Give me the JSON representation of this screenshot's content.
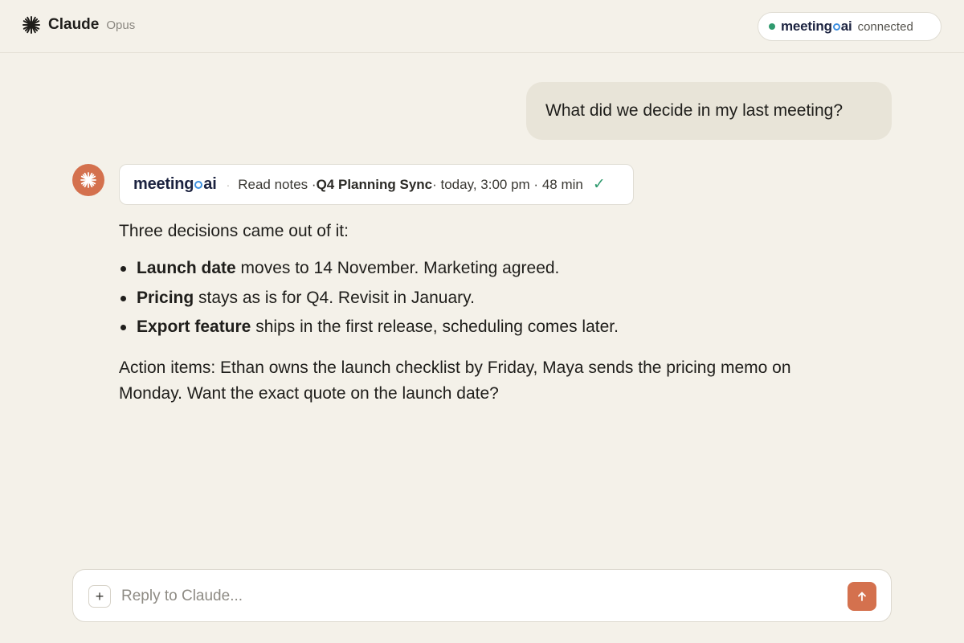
{
  "header": {
    "app_name": "Claude",
    "model": "Opus",
    "connection": {
      "brand_prefix": "meeting",
      "brand_suffix": "ai",
      "status": "connected",
      "status_color": "#2f9a6e"
    }
  },
  "conversation": {
    "user_message": "What did we decide in my last meeting?",
    "tool_call": {
      "brand_prefix": "meeting",
      "brand_suffix": "ai",
      "separator": "·",
      "action": "Read notes · ",
      "meeting_title": "Q4 Planning Sync",
      "details": " · today, 3:00 pm · 48 min",
      "check": "✓",
      "check_icon": "check-icon"
    },
    "reply": {
      "intro": "Three decisions came out of it:",
      "decisions": [
        {
          "bold": "Launch date",
          "text": " moves to 14 November. Marketing agreed."
        },
        {
          "bold": "Pricing",
          "text": " stays as is for Q4. Revisit in January."
        },
        {
          "bold": "Export feature",
          "text": " ships in the first release, scheduling comes later."
        }
      ],
      "action_items": "Action items: Ethan owns the launch checklist by Friday, Maya sends the pricing memo on Monday. Want the exact quote on the launch date?"
    }
  },
  "composer": {
    "placeholder": "Reply to Claude...",
    "value": "",
    "plus_label": "+",
    "send_icon": "arrow-up-icon"
  },
  "colors": {
    "background": "#f4f1e9",
    "accent": "#d4714e",
    "user_bubble": "#e8e4d8",
    "brand_dark": "#1c2340",
    "brand_blue": "#3d8fe0"
  }
}
